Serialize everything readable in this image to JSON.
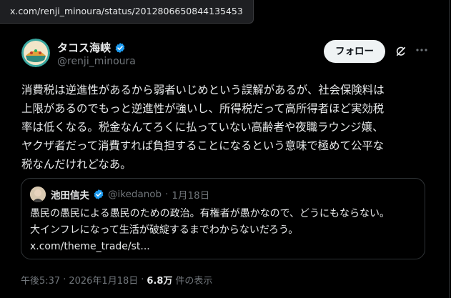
{
  "url_chip": "x.com/renji_minoura/status/2012806650844135453",
  "author": {
    "display_name": "タコス海峡",
    "handle": "@renji_minoura",
    "verified": true
  },
  "follow_label": "フォロー",
  "icons": {
    "grok": "grok-icon",
    "more": "more-icon",
    "verified": "verified-badge-icon"
  },
  "tweet_text": "消費税は逆進性があるから弱者いじめという誤解があるが、社会保険料は\n上限があるのでもっと逆進性が強いし、所得税だって高所得者ほど実効税\n率は低くなる。税金なんてろくに払っていない高齢者や夜職ラウンジ嬢、\nヤクザ者だって消費すれば負担することになるという意味で極めて公平な\n税なんだけれどなあ。",
  "quote": {
    "display_name": "池田信夫",
    "handle": "@ikedanob",
    "date": "1月18日",
    "text": "愚民の愚民による愚民のための政治。有権者が愚かなので、どうにもならない。\n大インフレになって生活が破綻するまでわからないだろう。",
    "link": "x.com/theme_trade/st..."
  },
  "footer": {
    "time": "午後5:37",
    "date": "2026年1月18日",
    "views": "6.8万",
    "views_label": "件の表示"
  },
  "colors": {
    "background": "#000000",
    "text": "#e7e9ea",
    "muted": "#71767b",
    "verified": "#1d9bf0"
  }
}
